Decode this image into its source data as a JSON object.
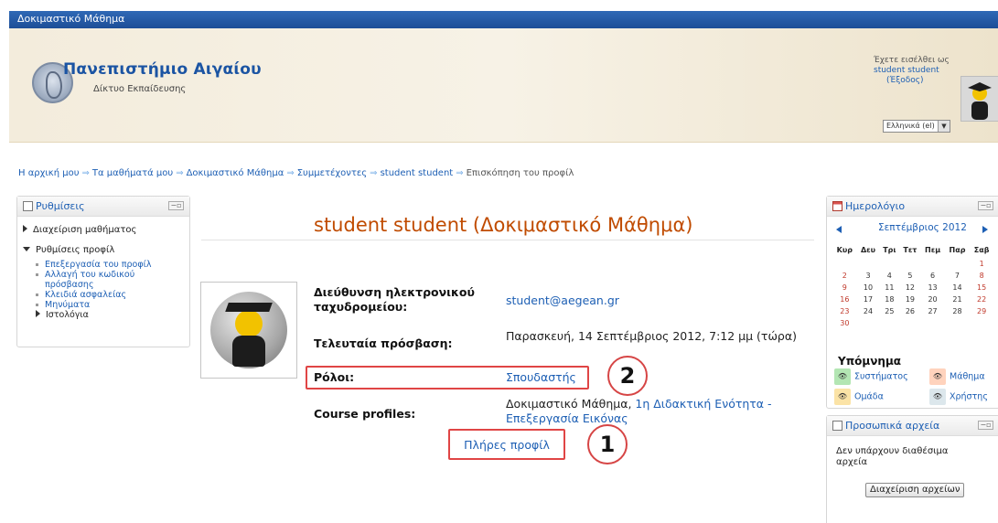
{
  "app": {
    "course_name": "Δοκιμαστικό Μάθημα",
    "university": "Πανεπιστήμιο Αιγαίου",
    "university_sub": "Δίκτυο Εκπαίδευσης"
  },
  "login": {
    "line1": "Έχετε εισέλθει ως",
    "user": "student student",
    "logout": "(Έξοδος)",
    "language": "Ελληνικά (el)"
  },
  "breadcrumb": {
    "items": [
      "Η αρχική μου",
      "Τα μαθήματά μου",
      "Δοκιμαστικό Μάθημα",
      "Συμμετέχοντες",
      "student student",
      "Επισκόπηση του προφίλ"
    ],
    "separator": "⇒"
  },
  "settings": {
    "title": "Ρυθμίσεις",
    "course_admin": "Διαχείριση μαθήματος",
    "profile_settings": "Ρυθμίσεις προφίλ",
    "sub_items": [
      "Επεξεργασία του προφίλ",
      "Αλλαγή του κωδικού πρόσβασης",
      "Κλειδιά ασφαλείας",
      "Μηνύματα"
    ],
    "blogs": "Ιστολόγια"
  },
  "profile": {
    "title": "student student (Δοκιμαστικό Μάθημα)",
    "email_label": "Διεύθυνση ηλεκτρονικού ταχυδρομείου:",
    "email": "student@aegean.gr",
    "last_access_label": "Τελευταία πρόσβαση:",
    "last_access": "Παρασκευή, 14 Σεπτέμβριος 2012, 7:12 μμ (τώρα)",
    "roles_label": "Ρόλοι:",
    "role": "Σπουδαστής",
    "course_profiles_label": "Course profiles:",
    "course_profile_course": "Δοκιμαστικό Μάθημα",
    "course_profile_sep": ", ",
    "course_profile_link": "1η Διδακτική Ενότητα - Επεξεργασία Εικόνας",
    "full_profile": "Πλήρες προφίλ"
  },
  "annotations": {
    "badge1": "1",
    "badge2": "2"
  },
  "calendar": {
    "title": "Ημερολόγιο",
    "month": "Σεπτέμβριος 2012",
    "weekdays": [
      "Κυρ",
      "Δευ",
      "Τρι",
      "Τετ",
      "Πεμ",
      "Παρ",
      "Σαβ"
    ],
    "weeks": [
      [
        "",
        "",
        "",
        "",
        "",
        "",
        "1"
      ],
      [
        "2",
        "3",
        "4",
        "5",
        "6",
        "7",
        "8"
      ],
      [
        "9",
        "10",
        "11",
        "12",
        "13",
        "14",
        "15"
      ],
      [
        "16",
        "17",
        "18",
        "19",
        "20",
        "21",
        "22"
      ],
      [
        "23",
        "24",
        "25",
        "26",
        "27",
        "28",
        "29"
      ],
      [
        "30",
        "",
        "",
        "",
        "",
        "",
        ""
      ]
    ],
    "legend_title": "Υπόμνημα",
    "legend": {
      "system": "Συστήματος",
      "course": "Μάθημα",
      "group": "Ομάδα",
      "user": "Χρήστης"
    },
    "legend_colors": {
      "system": "#b3e6b3",
      "course": "#ffd3bd",
      "group": "#fbe3a6",
      "user": "#dce7ec"
    }
  },
  "files": {
    "title": "Προσωπικά αρχεία",
    "empty": "Δεν υπάρχουν διαθέσιμα αρχεία",
    "manage": "Διαχείριση αρχείων"
  }
}
